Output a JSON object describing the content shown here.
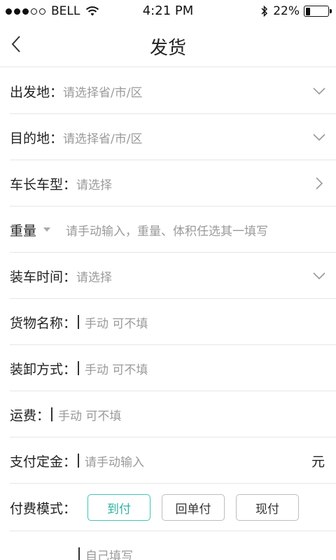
{
  "status_bar": {
    "carrier": "BELL",
    "time": "4:21 PM",
    "battery_text": "22%",
    "battery_level": 0.22
  },
  "nav": {
    "title": "发货"
  },
  "form": {
    "origin": {
      "label": "出发地：",
      "placeholder": "请选择省/市/区"
    },
    "destination": {
      "label": "目的地：",
      "placeholder": "请选择省/市/区"
    },
    "truck": {
      "label": "车长车型：",
      "placeholder": "请选择"
    },
    "weight": {
      "label": "重量",
      "placeholder": "请手动输入，重量、体积任选其一填写"
    },
    "load_time": {
      "label": "装车时间：",
      "placeholder": "请选择"
    },
    "cargo_name": {
      "label": "货物名称：",
      "placeholder": "手动 可不填"
    },
    "load_method": {
      "label": "装卸方式：",
      "placeholder": "手动 可不填"
    },
    "freight": {
      "label": "运费：",
      "placeholder": "手动 可不填"
    },
    "deposit": {
      "label": "支付定金：",
      "placeholder": "请手动输入",
      "unit": "元"
    },
    "pay_mode": {
      "label": "付费模式：",
      "options": [
        "到付",
        "回单付",
        "现付"
      ],
      "selected": "到付"
    },
    "custom": {
      "placeholder": "自己填写"
    }
  },
  "colors": {
    "accent": "#3cc6b4",
    "divider": "#e6e6e6",
    "placeholder": "#9a9a9a"
  }
}
